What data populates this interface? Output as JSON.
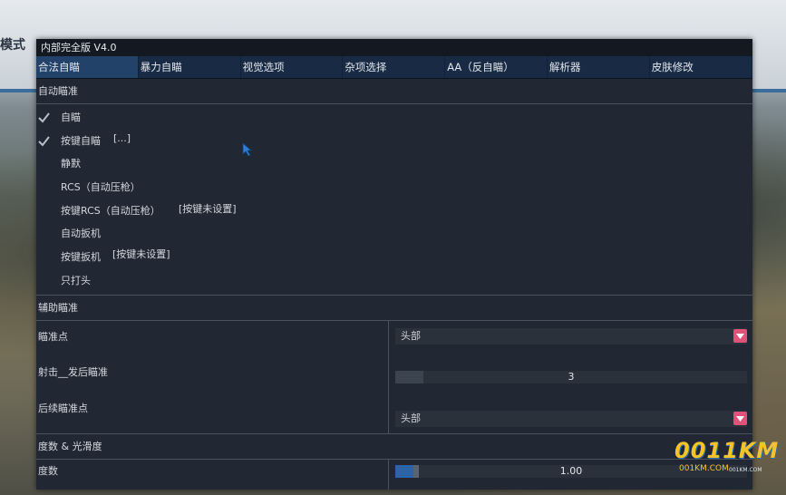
{
  "background": {
    "mode_text": "模式"
  },
  "window": {
    "title": "内部完全版 V4.0"
  },
  "tabs": [
    {
      "label": "合法自瞄",
      "active": true
    },
    {
      "label": "暴力自瞄",
      "active": false
    },
    {
      "label": "视觉选项",
      "active": false
    },
    {
      "label": "杂项选择",
      "active": false
    },
    {
      "label": "AA（反自瞄）",
      "active": false
    },
    {
      "label": "解析器",
      "active": false
    },
    {
      "label": "皮肤修改",
      "active": false
    }
  ],
  "auto_aim": {
    "header": "自动瞄准",
    "items": [
      {
        "label": "自瞄",
        "checked": true,
        "extra": ""
      },
      {
        "label": "按键自瞄",
        "checked": true,
        "extra": "[...]"
      },
      {
        "label": "静默",
        "checked": false,
        "extra": ""
      },
      {
        "label": "RCS（自动压枪）",
        "checked": false,
        "extra": ""
      },
      {
        "label": "按键RCS（自动压枪）",
        "checked": false,
        "extra": "[按键未设置]"
      },
      {
        "label": "自动扳机",
        "checked": false,
        "extra": ""
      },
      {
        "label": "按键扳机",
        "checked": false,
        "extra": "[按键未设置]"
      },
      {
        "label": "只打头",
        "checked": false,
        "extra": ""
      }
    ]
  },
  "assist_aim": {
    "header": "辅助瞄准",
    "aim_point": {
      "label": "瞄准点",
      "value": "头部"
    },
    "shots_after": {
      "label": "射击__发后瞄准",
      "value": "3",
      "fill_fraction": 0.08
    },
    "follow_point": {
      "label": "后续瞄准点",
      "value": "头部"
    }
  },
  "fov_smooth": {
    "header": "度数 & 光滑度",
    "fov": {
      "label": "度数",
      "value": "1.00",
      "fill_fraction": 0.06
    }
  },
  "watermark": {
    "logo": "0011KM",
    "site": "001KM.COM",
    "site_small": "001KM.COM"
  },
  "colors": {
    "accent": "#e0527a",
    "tab_active": "#23426a",
    "panel": "#212833"
  }
}
